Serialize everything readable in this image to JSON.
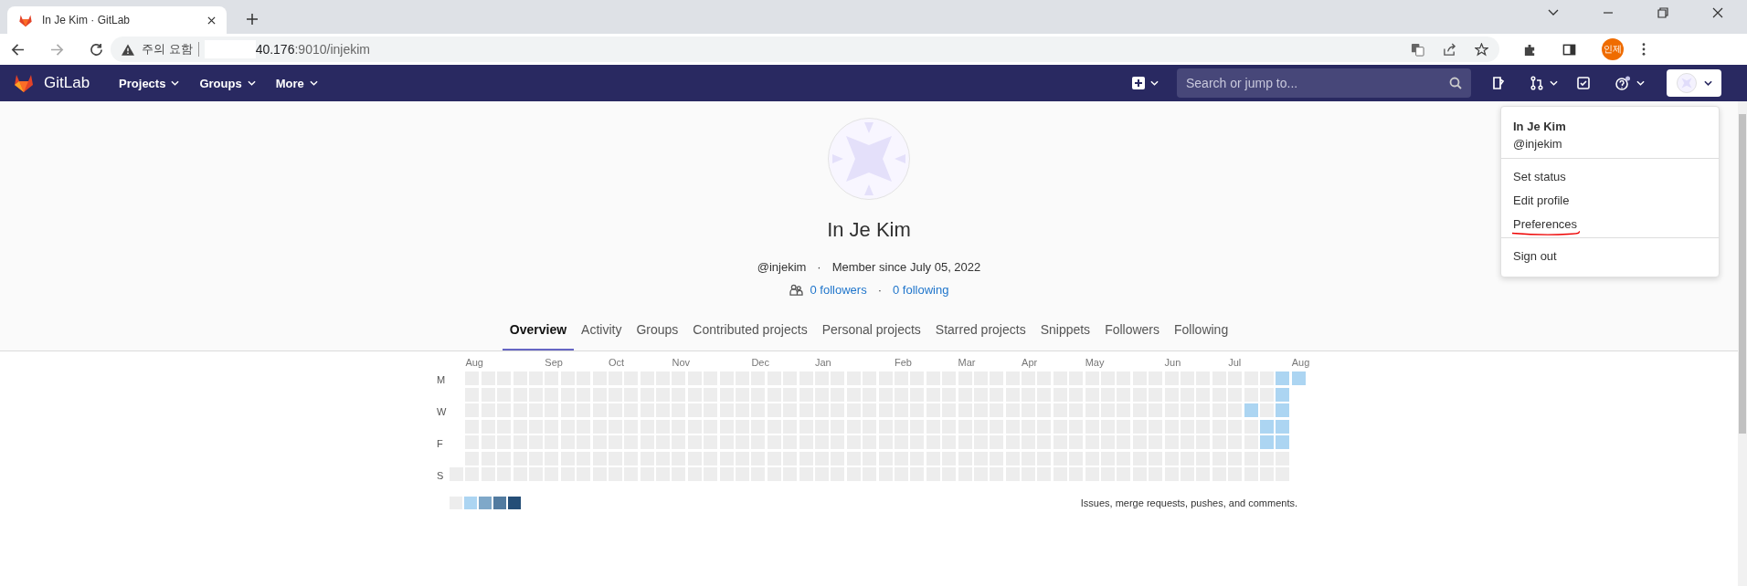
{
  "browser": {
    "tab_title": "In Je Kim · GitLab",
    "security_label": "주의 요함",
    "url_host": "40.176",
    "url_path": ":9010/injekim",
    "profile_badge": "인제"
  },
  "navbar": {
    "brand": "GitLab",
    "menus": [
      "Projects",
      "Groups",
      "More"
    ],
    "search": {
      "placeholder": "Search or jump to..."
    }
  },
  "profile": {
    "name": "In Je Kim",
    "username": "@injekim",
    "dot_1": "·",
    "member_since": "Member since July 05, 2022",
    "followers": "0 followers",
    "dot_2": "·",
    "following": "0 following"
  },
  "tabs": [
    {
      "label": "Overview",
      "selected": true
    },
    {
      "label": "Activity",
      "selected": false
    },
    {
      "label": "Groups",
      "selected": false
    },
    {
      "label": "Contributed projects",
      "selected": false
    },
    {
      "label": "Personal projects",
      "selected": false
    },
    {
      "label": "Starred projects",
      "selected": false
    },
    {
      "label": "Snippets",
      "selected": false
    },
    {
      "label": "Followers",
      "selected": false
    },
    {
      "label": "Following",
      "selected": false
    }
  ],
  "calendar": {
    "day_labels": [
      "M",
      "W",
      "F",
      "S"
    ],
    "weeks": [
      {
        "days": [
          {
            "color": "#ededed"
          }
        ]
      },
      {
        "month": "Aug",
        "days": [
          {
            "color": "#ededed"
          },
          {
            "color": "#ededed"
          },
          {
            "color": "#ededed"
          },
          {
            "color": "#ededed"
          },
          {
            "color": "#ededed"
          },
          {
            "color": "#ededed"
          },
          {
            "color": "#ededed"
          }
        ]
      },
      {
        "days": [
          {
            "color": "#ededed"
          },
          {
            "color": "#ededed"
          },
          {
            "color": "#ededed"
          },
          {
            "color": "#ededed"
          },
          {
            "color": "#ededed"
          },
          {
            "color": "#ededed"
          },
          {
            "color": "#ededed"
          }
        ]
      },
      {
        "days": [
          {
            "color": "#ededed"
          },
          {
            "color": "#ededed"
          },
          {
            "color": "#ededed"
          },
          {
            "color": "#ededed"
          },
          {
            "color": "#ededed"
          },
          {
            "color": "#ededed"
          },
          {
            "color": "#ededed"
          }
        ]
      },
      {
        "days": [
          {
            "color": "#ededed"
          },
          {
            "color": "#ededed"
          },
          {
            "color": "#ededed"
          },
          {
            "color": "#ededed"
          },
          {
            "color": "#ededed"
          },
          {
            "color": "#ededed"
          },
          {
            "color": "#ededed"
          }
        ]
      },
      {
        "days": [
          {
            "color": "#ededed"
          },
          {
            "color": "#ededed"
          },
          {
            "color": "#ededed"
          },
          {
            "color": "#ededed"
          },
          {
            "color": "#ededed"
          },
          {
            "color": "#ededed"
          },
          {
            "color": "#ededed"
          }
        ]
      },
      {
        "month": "Sep",
        "days": [
          {
            "color": "#ededed"
          },
          {
            "color": "#ededed"
          },
          {
            "color": "#ededed"
          },
          {
            "color": "#ededed"
          },
          {
            "color": "#ededed"
          },
          {
            "color": "#ededed"
          },
          {
            "color": "#ededed"
          }
        ]
      },
      {
        "days": [
          {
            "color": "#ededed"
          },
          {
            "color": "#ededed"
          },
          {
            "color": "#ededed"
          },
          {
            "color": "#ededed"
          },
          {
            "color": "#ededed"
          },
          {
            "color": "#ededed"
          },
          {
            "color": "#ededed"
          }
        ]
      },
      {
        "days": [
          {
            "color": "#ededed"
          },
          {
            "color": "#ededed"
          },
          {
            "color": "#ededed"
          },
          {
            "color": "#ededed"
          },
          {
            "color": "#ededed"
          },
          {
            "color": "#ededed"
          },
          {
            "color": "#ededed"
          }
        ]
      },
      {
        "days": [
          {
            "color": "#ededed"
          },
          {
            "color": "#ededed"
          },
          {
            "color": "#ededed"
          },
          {
            "color": "#ededed"
          },
          {
            "color": "#ededed"
          },
          {
            "color": "#ededed"
          },
          {
            "color": "#ededed"
          }
        ]
      },
      {
        "month": "Oct",
        "days": [
          {
            "color": "#ededed"
          },
          {
            "color": "#ededed"
          },
          {
            "color": "#ededed"
          },
          {
            "color": "#ededed"
          },
          {
            "color": "#ededed"
          },
          {
            "color": "#ededed"
          },
          {
            "color": "#ededed"
          }
        ]
      },
      {
        "days": [
          {
            "color": "#ededed"
          },
          {
            "color": "#ededed"
          },
          {
            "color": "#ededed"
          },
          {
            "color": "#ededed"
          },
          {
            "color": "#ededed"
          },
          {
            "color": "#ededed"
          },
          {
            "color": "#ededed"
          }
        ]
      },
      {
        "days": [
          {
            "color": "#ededed"
          },
          {
            "color": "#ededed"
          },
          {
            "color": "#ededed"
          },
          {
            "color": "#ededed"
          },
          {
            "color": "#ededed"
          },
          {
            "color": "#ededed"
          },
          {
            "color": "#ededed"
          }
        ]
      },
      {
        "days": [
          {
            "color": "#ededed"
          },
          {
            "color": "#ededed"
          },
          {
            "color": "#ededed"
          },
          {
            "color": "#ededed"
          },
          {
            "color": "#ededed"
          },
          {
            "color": "#ededed"
          },
          {
            "color": "#ededed"
          }
        ]
      },
      {
        "month": "Nov",
        "days": [
          {
            "color": "#ededed"
          },
          {
            "color": "#ededed"
          },
          {
            "color": "#ededed"
          },
          {
            "color": "#ededed"
          },
          {
            "color": "#ededed"
          },
          {
            "color": "#ededed"
          },
          {
            "color": "#ededed"
          }
        ]
      },
      {
        "days": [
          {
            "color": "#ededed"
          },
          {
            "color": "#ededed"
          },
          {
            "color": "#ededed"
          },
          {
            "color": "#ededed"
          },
          {
            "color": "#ededed"
          },
          {
            "color": "#ededed"
          },
          {
            "color": "#ededed"
          }
        ]
      },
      {
        "days": [
          {
            "color": "#ededed"
          },
          {
            "color": "#ededed"
          },
          {
            "color": "#ededed"
          },
          {
            "color": "#ededed"
          },
          {
            "color": "#ededed"
          },
          {
            "color": "#ededed"
          },
          {
            "color": "#ededed"
          }
        ]
      },
      {
        "days": [
          {
            "color": "#ededed"
          },
          {
            "color": "#ededed"
          },
          {
            "color": "#ededed"
          },
          {
            "color": "#ededed"
          },
          {
            "color": "#ededed"
          },
          {
            "color": "#ededed"
          },
          {
            "color": "#ededed"
          }
        ]
      },
      {
        "days": [
          {
            "color": "#ededed"
          },
          {
            "color": "#ededed"
          },
          {
            "color": "#ededed"
          },
          {
            "color": "#ededed"
          },
          {
            "color": "#ededed"
          },
          {
            "color": "#ededed"
          },
          {
            "color": "#ededed"
          }
        ]
      },
      {
        "month": "Dec",
        "days": [
          {
            "color": "#ededed"
          },
          {
            "color": "#ededed"
          },
          {
            "color": "#ededed"
          },
          {
            "color": "#ededed"
          },
          {
            "color": "#ededed"
          },
          {
            "color": "#ededed"
          },
          {
            "color": "#ededed"
          }
        ]
      },
      {
        "days": [
          {
            "color": "#ededed"
          },
          {
            "color": "#ededed"
          },
          {
            "color": "#ededed"
          },
          {
            "color": "#ededed"
          },
          {
            "color": "#ededed"
          },
          {
            "color": "#ededed"
          },
          {
            "color": "#ededed"
          }
        ]
      },
      {
        "days": [
          {
            "color": "#ededed"
          },
          {
            "color": "#ededed"
          },
          {
            "color": "#ededed"
          },
          {
            "color": "#ededed"
          },
          {
            "color": "#ededed"
          },
          {
            "color": "#ededed"
          },
          {
            "color": "#ededed"
          }
        ]
      },
      {
        "days": [
          {
            "color": "#ededed"
          },
          {
            "color": "#ededed"
          },
          {
            "color": "#ededed"
          },
          {
            "color": "#ededed"
          },
          {
            "color": "#ededed"
          },
          {
            "color": "#ededed"
          },
          {
            "color": "#ededed"
          }
        ]
      },
      {
        "month": "Jan",
        "days": [
          {
            "color": "#ededed"
          },
          {
            "color": "#ededed"
          },
          {
            "color": "#ededed"
          },
          {
            "color": "#ededed"
          },
          {
            "color": "#ededed"
          },
          {
            "color": "#ededed"
          },
          {
            "color": "#ededed"
          }
        ]
      },
      {
        "days": [
          {
            "color": "#ededed"
          },
          {
            "color": "#ededed"
          },
          {
            "color": "#ededed"
          },
          {
            "color": "#ededed"
          },
          {
            "color": "#ededed"
          },
          {
            "color": "#ededed"
          },
          {
            "color": "#ededed"
          }
        ]
      },
      {
        "days": [
          {
            "color": "#ededed"
          },
          {
            "color": "#ededed"
          },
          {
            "color": "#ededed"
          },
          {
            "color": "#ededed"
          },
          {
            "color": "#ededed"
          },
          {
            "color": "#ededed"
          },
          {
            "color": "#ededed"
          }
        ]
      },
      {
        "days": [
          {
            "color": "#ededed"
          },
          {
            "color": "#ededed"
          },
          {
            "color": "#ededed"
          },
          {
            "color": "#ededed"
          },
          {
            "color": "#ededed"
          },
          {
            "color": "#ededed"
          },
          {
            "color": "#ededed"
          }
        ]
      },
      {
        "days": [
          {
            "color": "#ededed"
          },
          {
            "color": "#ededed"
          },
          {
            "color": "#ededed"
          },
          {
            "color": "#ededed"
          },
          {
            "color": "#ededed"
          },
          {
            "color": "#ededed"
          },
          {
            "color": "#ededed"
          }
        ]
      },
      {
        "month": "Feb",
        "days": [
          {
            "color": "#ededed"
          },
          {
            "color": "#ededed"
          },
          {
            "color": "#ededed"
          },
          {
            "color": "#ededed"
          },
          {
            "color": "#ededed"
          },
          {
            "color": "#ededed"
          },
          {
            "color": "#ededed"
          }
        ]
      },
      {
        "days": [
          {
            "color": "#ededed"
          },
          {
            "color": "#ededed"
          },
          {
            "color": "#ededed"
          },
          {
            "color": "#ededed"
          },
          {
            "color": "#ededed"
          },
          {
            "color": "#ededed"
          },
          {
            "color": "#ededed"
          }
        ]
      },
      {
        "days": [
          {
            "color": "#ededed"
          },
          {
            "color": "#ededed"
          },
          {
            "color": "#ededed"
          },
          {
            "color": "#ededed"
          },
          {
            "color": "#ededed"
          },
          {
            "color": "#ededed"
          },
          {
            "color": "#ededed"
          }
        ]
      },
      {
        "days": [
          {
            "color": "#ededed"
          },
          {
            "color": "#ededed"
          },
          {
            "color": "#ededed"
          },
          {
            "color": "#ededed"
          },
          {
            "color": "#ededed"
          },
          {
            "color": "#ededed"
          },
          {
            "color": "#ededed"
          }
        ]
      },
      {
        "month": "Mar",
        "days": [
          {
            "color": "#ededed"
          },
          {
            "color": "#ededed"
          },
          {
            "color": "#ededed"
          },
          {
            "color": "#ededed"
          },
          {
            "color": "#ededed"
          },
          {
            "color": "#ededed"
          },
          {
            "color": "#ededed"
          }
        ]
      },
      {
        "days": [
          {
            "color": "#ededed"
          },
          {
            "color": "#ededed"
          },
          {
            "color": "#ededed"
          },
          {
            "color": "#ededed"
          },
          {
            "color": "#ededed"
          },
          {
            "color": "#ededed"
          },
          {
            "color": "#ededed"
          }
        ]
      },
      {
        "days": [
          {
            "color": "#ededed"
          },
          {
            "color": "#ededed"
          },
          {
            "color": "#ededed"
          },
          {
            "color": "#ededed"
          },
          {
            "color": "#ededed"
          },
          {
            "color": "#ededed"
          },
          {
            "color": "#ededed"
          }
        ]
      },
      {
        "days": [
          {
            "color": "#ededed"
          },
          {
            "color": "#ededed"
          },
          {
            "color": "#ededed"
          },
          {
            "color": "#ededed"
          },
          {
            "color": "#ededed"
          },
          {
            "color": "#ededed"
          },
          {
            "color": "#ededed"
          }
        ]
      },
      {
        "month": "Apr",
        "days": [
          {
            "color": "#ededed"
          },
          {
            "color": "#ededed"
          },
          {
            "color": "#ededed"
          },
          {
            "color": "#ededed"
          },
          {
            "color": "#ededed"
          },
          {
            "color": "#ededed"
          },
          {
            "color": "#ededed"
          }
        ]
      },
      {
        "days": [
          {
            "color": "#ededed"
          },
          {
            "color": "#ededed"
          },
          {
            "color": "#ededed"
          },
          {
            "color": "#ededed"
          },
          {
            "color": "#ededed"
          },
          {
            "color": "#ededed"
          },
          {
            "color": "#ededed"
          }
        ]
      },
      {
        "days": [
          {
            "color": "#ededed"
          },
          {
            "color": "#ededed"
          },
          {
            "color": "#ededed"
          },
          {
            "color": "#ededed"
          },
          {
            "color": "#ededed"
          },
          {
            "color": "#ededed"
          },
          {
            "color": "#ededed"
          }
        ]
      },
      {
        "days": [
          {
            "color": "#ededed"
          },
          {
            "color": "#ededed"
          },
          {
            "color": "#ededed"
          },
          {
            "color": "#ededed"
          },
          {
            "color": "#ededed"
          },
          {
            "color": "#ededed"
          },
          {
            "color": "#ededed"
          }
        ]
      },
      {
        "month": "May",
        "days": [
          {
            "color": "#ededed"
          },
          {
            "color": "#ededed"
          },
          {
            "color": "#ededed"
          },
          {
            "color": "#ededed"
          },
          {
            "color": "#ededed"
          },
          {
            "color": "#ededed"
          },
          {
            "color": "#ededed"
          }
        ]
      },
      {
        "days": [
          {
            "color": "#ededed"
          },
          {
            "color": "#ededed"
          },
          {
            "color": "#ededed"
          },
          {
            "color": "#ededed"
          },
          {
            "color": "#ededed"
          },
          {
            "color": "#ededed"
          },
          {
            "color": "#ededed"
          }
        ]
      },
      {
        "days": [
          {
            "color": "#ededed"
          },
          {
            "color": "#ededed"
          },
          {
            "color": "#ededed"
          },
          {
            "color": "#ededed"
          },
          {
            "color": "#ededed"
          },
          {
            "color": "#ededed"
          },
          {
            "color": "#ededed"
          }
        ]
      },
      {
        "days": [
          {
            "color": "#ededed"
          },
          {
            "color": "#ededed"
          },
          {
            "color": "#ededed"
          },
          {
            "color": "#ededed"
          },
          {
            "color": "#ededed"
          },
          {
            "color": "#ededed"
          },
          {
            "color": "#ededed"
          }
        ]
      },
      {
        "days": [
          {
            "color": "#ededed"
          },
          {
            "color": "#ededed"
          },
          {
            "color": "#ededed"
          },
          {
            "color": "#ededed"
          },
          {
            "color": "#ededed"
          },
          {
            "color": "#ededed"
          },
          {
            "color": "#ededed"
          }
        ]
      },
      {
        "month": "Jun",
        "days": [
          {
            "color": "#ededed"
          },
          {
            "color": "#ededed"
          },
          {
            "color": "#ededed"
          },
          {
            "color": "#ededed"
          },
          {
            "color": "#ededed"
          },
          {
            "color": "#ededed"
          },
          {
            "color": "#ededed"
          }
        ]
      },
      {
        "days": [
          {
            "color": "#ededed"
          },
          {
            "color": "#ededed"
          },
          {
            "color": "#ededed"
          },
          {
            "color": "#ededed"
          },
          {
            "color": "#ededed"
          },
          {
            "color": "#ededed"
          },
          {
            "color": "#ededed"
          }
        ]
      },
      {
        "days": [
          {
            "color": "#ededed"
          },
          {
            "color": "#ededed"
          },
          {
            "color": "#ededed"
          },
          {
            "color": "#ededed"
          },
          {
            "color": "#ededed"
          },
          {
            "color": "#ededed"
          },
          {
            "color": "#ededed"
          }
        ]
      },
      {
        "days": [
          {
            "color": "#ededed"
          },
          {
            "color": "#ededed"
          },
          {
            "color": "#ededed"
          },
          {
            "color": "#ededed"
          },
          {
            "color": "#ededed"
          },
          {
            "color": "#ededed"
          },
          {
            "color": "#ededed"
          }
        ]
      },
      {
        "month": "Jul",
        "days": [
          {
            "color": "#ededed"
          },
          {
            "color": "#ededed"
          },
          {
            "color": "#ededed"
          },
          {
            "color": "#ededed"
          },
          {
            "color": "#ededed"
          },
          {
            "color": "#ededed"
          },
          {
            "color": "#ededed"
          }
        ]
      },
      {
        "days": [
          {
            "color": "#ededed"
          },
          {
            "color": "#ededed"
          },
          {
            "color": "#acd5f2"
          },
          {
            "color": "#ededed"
          },
          {
            "color": "#ededed"
          },
          {
            "color": "#ededed"
          },
          {
            "color": "#ededed"
          }
        ]
      },
      {
        "days": [
          {
            "color": "#ededed"
          },
          {
            "color": "#ededed"
          },
          {
            "color": "#ededed"
          },
          {
            "color": "#acd5f2"
          },
          {
            "color": "#acd5f2"
          },
          {
            "color": "#ededed"
          },
          {
            "color": "#ededed"
          }
        ]
      },
      {
        "days": [
          {
            "color": "#acd5f2"
          },
          {
            "color": "#acd5f2"
          },
          {
            "color": "#acd5f2"
          },
          {
            "color": "#acd5f2"
          },
          {
            "color": "#acd5f2"
          },
          {
            "color": "#ededed"
          },
          {
            "color": "#ededed"
          }
        ]
      },
      {
        "month": "Aug",
        "days": [
          {
            "color": "#acd5f2"
          }
        ]
      }
    ],
    "legend": [
      {
        "color": "#ededed"
      },
      {
        "color": "#acd5f2"
      },
      {
        "color": "#7fa8c9"
      },
      {
        "color": "#527ba0"
      },
      {
        "color": "#254e77"
      }
    ],
    "legend_text": "Issues, merge requests, pushes, and comments."
  },
  "user_menu": {
    "name": "In Je Kim",
    "username": "@injekim",
    "sections": [
      [
        {
          "label": "Set status",
          "underlined": false
        },
        {
          "label": "Edit profile",
          "underlined": false
        },
        {
          "label": "Preferences",
          "underlined": true
        }
      ],
      [
        {
          "label": "Sign out",
          "underlined": false
        }
      ]
    ]
  }
}
